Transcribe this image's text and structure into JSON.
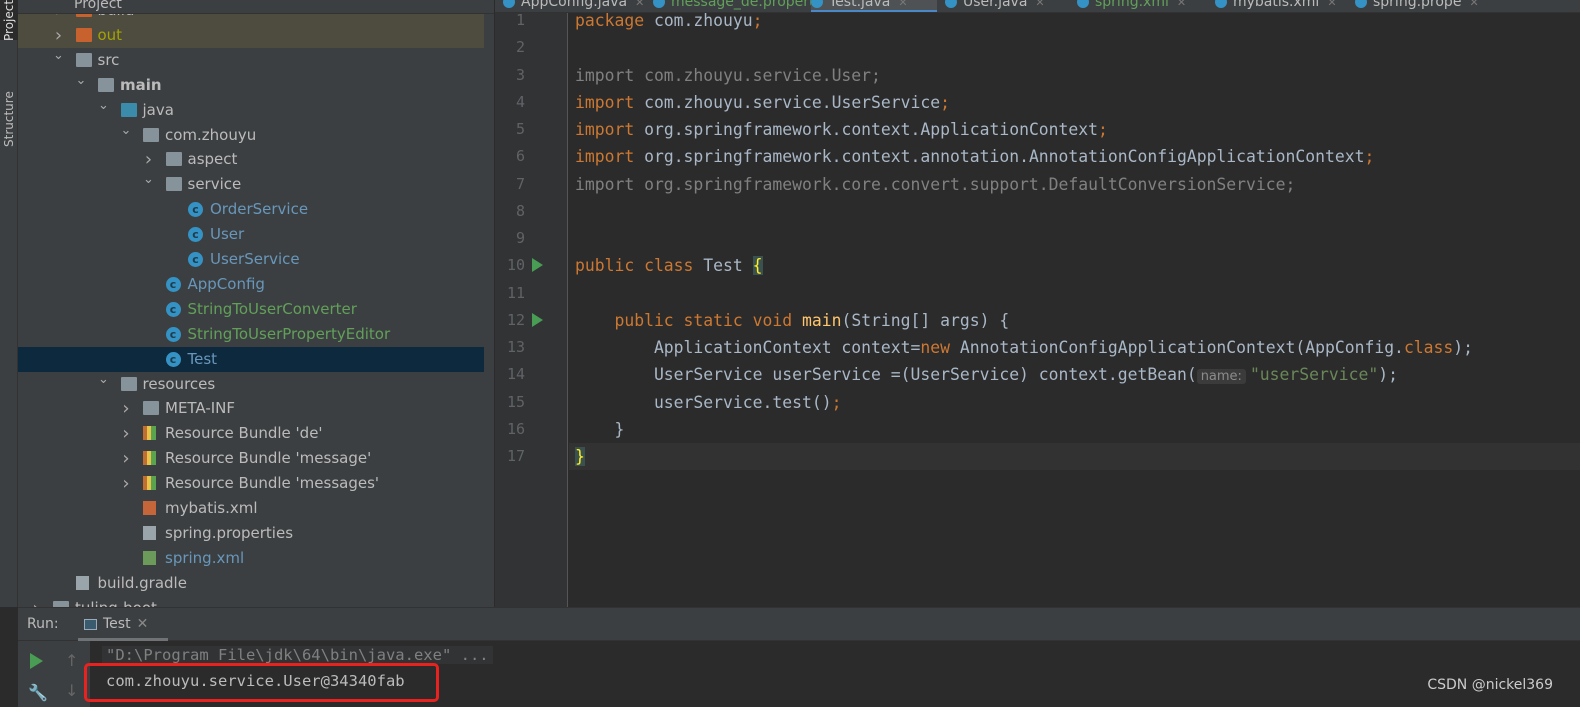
{
  "sidebar": {
    "project_tab": "Project",
    "structure_tab": "Structure",
    "header_label": "Project"
  },
  "tree": [
    {
      "label": "build",
      "level": 3,
      "kind": "folder-orange",
      "arrow": "right",
      "state": "excluded"
    },
    {
      "label": "out",
      "level": 3,
      "kind": "folder-orange",
      "arrow": "right",
      "state": "excluded",
      "color": "#a4a400"
    },
    {
      "label": "src",
      "level": 3,
      "kind": "folder",
      "arrow": "down"
    },
    {
      "label": "main",
      "level": 4,
      "kind": "folder",
      "arrow": "down",
      "bold": true
    },
    {
      "label": "java",
      "level": 5,
      "kind": "folder-blue",
      "arrow": "down"
    },
    {
      "label": "com.zhouyu",
      "level": 6,
      "kind": "folder",
      "arrow": "down"
    },
    {
      "label": "aspect",
      "level": 7,
      "kind": "folder",
      "arrow": "right"
    },
    {
      "label": "service",
      "level": 7,
      "kind": "folder",
      "arrow": "down"
    },
    {
      "label": "OrderService",
      "level": 8,
      "kind": "class",
      "color": "#6897bb"
    },
    {
      "label": "User",
      "level": 8,
      "kind": "class",
      "color": "#6897bb"
    },
    {
      "label": "UserService",
      "level": 8,
      "kind": "class",
      "color": "#6897bb"
    },
    {
      "label": "AppConfig",
      "level": 7,
      "kind": "class",
      "color": "#6897bb"
    },
    {
      "label": "StringToUserConverter",
      "level": 7,
      "kind": "class",
      "color": "#62a05a"
    },
    {
      "label": "StringToUserPropertyEditor",
      "level": 7,
      "kind": "class",
      "color": "#62a05a"
    },
    {
      "label": "Test",
      "level": 7,
      "kind": "class",
      "color": "#6897bb",
      "state": "selected"
    },
    {
      "label": "resources",
      "level": 5,
      "kind": "folder",
      "arrow": "down"
    },
    {
      "label": "META-INF",
      "level": 6,
      "kind": "folder",
      "arrow": "right"
    },
    {
      "label": "Resource Bundle 'de'",
      "level": 6,
      "kind": "props",
      "arrow": "right"
    },
    {
      "label": "Resource Bundle 'message'",
      "level": 6,
      "kind": "props",
      "arrow": "right"
    },
    {
      "label": "Resource Bundle 'messages'",
      "level": 6,
      "kind": "props",
      "arrow": "right"
    },
    {
      "label": "mybatis.xml",
      "level": 6,
      "kind": "xml"
    },
    {
      "label": "spring.properties",
      "level": 6,
      "kind": "file"
    },
    {
      "label": "spring.xml",
      "level": 6,
      "kind": "spring",
      "color": "#6897bb"
    },
    {
      "label": "build.gradle",
      "level": 3,
      "kind": "file"
    },
    {
      "label": "tuling-boot",
      "level": 2,
      "kind": "folder",
      "arrow": "right"
    }
  ],
  "tabs": [
    {
      "label": "AppConfig.java",
      "color": "#bbbbbb"
    },
    {
      "label": "message_de.properties",
      "color": "#62a05a"
    },
    {
      "label": "Test.java",
      "color": "#bbbbbb",
      "active": true
    },
    {
      "label": "User.java",
      "color": "#bbbbbb"
    },
    {
      "label": "spring.xml",
      "color": "#62a05a"
    },
    {
      "label": "mybatis.xml",
      "color": "#bbbbbb"
    },
    {
      "label": "spring.prope",
      "color": "#bbbbbb"
    }
  ],
  "code": {
    "current_line": 17,
    "run_markers": [
      10,
      12
    ],
    "lines": [
      [
        [
          "package",
          "kw"
        ],
        [
          " com.zhouyu",
          "plain"
        ],
        [
          ";",
          "kw"
        ]
      ],
      [],
      [
        [
          "import com.zhouyu.service.User;",
          "gray"
        ]
      ],
      [
        [
          "import",
          "kw"
        ],
        [
          " com.zhouyu.service.UserService",
          "plain"
        ],
        [
          ";",
          "kw"
        ]
      ],
      [
        [
          "import",
          "kw"
        ],
        [
          " org.springframework.context.ApplicationContext",
          "plain"
        ],
        [
          ";",
          "kw"
        ]
      ],
      [
        [
          "import",
          "kw"
        ],
        [
          " org.springframework.context.annotation.AnnotationConfigApplicationContext",
          "plain"
        ],
        [
          ";",
          "kw"
        ]
      ],
      [
        [
          "import org.springframework.core.convert.support.DefaultConversionService;",
          "gray"
        ]
      ],
      [],
      [],
      [
        [
          "public class ",
          "kw"
        ],
        [
          "Test ",
          "plain"
        ],
        [
          "{",
          "brace"
        ]
      ],
      [],
      [
        [
          "    public static void ",
          "kw"
        ],
        [
          "main",
          "fn"
        ],
        [
          "(String[] args) {",
          "plain"
        ]
      ],
      [
        [
          "        ApplicationContext context=",
          "plain"
        ],
        [
          "new",
          "kw"
        ],
        [
          " AnnotationConfigApplicationContext(AppConfig.",
          "plain"
        ],
        [
          "class",
          "kw"
        ],
        [
          ");",
          "plain"
        ]
      ],
      [
        [
          "        UserService userService =(UserService) context.getBean(",
          "plain"
        ],
        [
          "name:",
          "hint"
        ],
        [
          "\"userService\"",
          "str"
        ],
        [
          ");",
          "plain"
        ]
      ],
      [
        [
          "        userService.test()",
          "plain"
        ],
        [
          ";",
          "kw"
        ]
      ],
      [
        [
          "    }",
          "plain"
        ]
      ],
      [
        [
          "}",
          "brace"
        ]
      ]
    ]
  },
  "run": {
    "label": "Run:",
    "tab": "Test",
    "command": "\"D:\\Program File\\jdk\\64\\bin\\java.exe\" ...",
    "output": "com.zhouyu.service.User@34340fab"
  },
  "watermark": "CSDN @nickel369"
}
